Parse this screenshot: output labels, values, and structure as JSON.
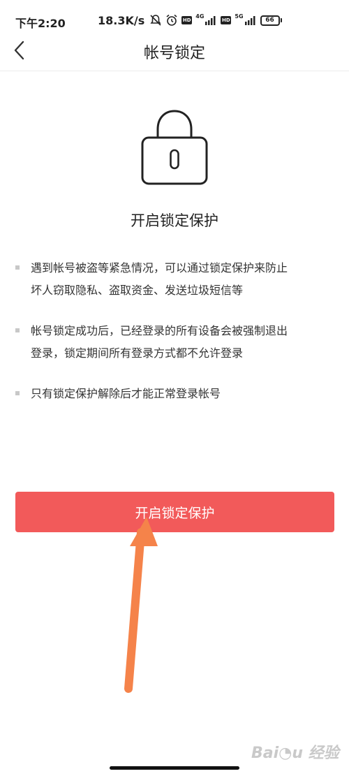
{
  "status_bar": {
    "time": "下午2:20",
    "speed": "18.3K/s",
    "icons": [
      "mute-icon",
      "alarm-icon",
      "hd-icon",
      "signal-4g-icon",
      "hd-icon",
      "signal-5g-icon",
      "battery-icon"
    ],
    "hd_label": "HD",
    "net1": "4G",
    "net2": "5G",
    "battery_level": "66"
  },
  "nav": {
    "title": "帐号锁定",
    "back_icon": "chevron-left-icon"
  },
  "illustration": {
    "icon": "lock-icon"
  },
  "heading": "开启锁定保护",
  "tips": [
    {
      "line1": "遇到帐号被盗等紧急情况，可以通过锁定保护来防止",
      "line2": "坏人窃取隐私、盗取资金、发送垃圾短信等"
    },
    {
      "line1": "帐号锁定成功后，已经登录的所有设备会被强制退出",
      "line2": "登录，锁定期间所有登录方式都不允许登录"
    },
    {
      "line1": "只有锁定保护解除后才能正常登录帐号",
      "line2": ""
    }
  ],
  "button": {
    "label": "开启锁定保护"
  },
  "colors": {
    "accent": "#f25a5a",
    "arrow": "#f5834a"
  },
  "watermark": "Baidu 经验"
}
